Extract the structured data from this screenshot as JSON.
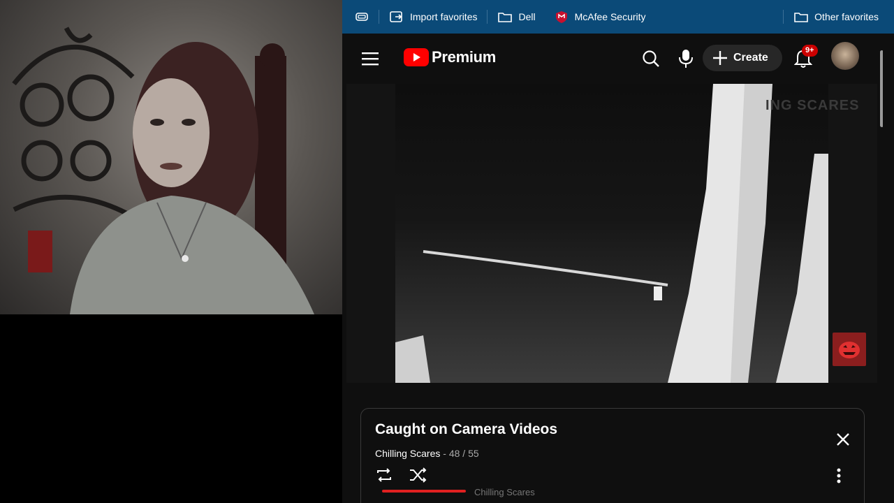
{
  "favorites_bar": {
    "items": [
      {
        "label": "Import favorites",
        "icon": "import-icon"
      },
      {
        "label": "Dell",
        "icon": "folder-icon"
      },
      {
        "label": "McAfee Security",
        "icon": "mcafee-shield-icon"
      }
    ],
    "other_favorites": {
      "label": "Other favorites",
      "icon": "folder-icon"
    }
  },
  "youtube": {
    "logo_text": "Premium",
    "create_label": "Create",
    "notification_badge": "9+",
    "accent_color": "#ff0000"
  },
  "video": {
    "watermark": "ING SCARES"
  },
  "playlist": {
    "title": "Caught on Camera Videos",
    "channel": "Chilling Scares",
    "separator": " - ",
    "position": "48 / 55",
    "next_item_channel": "Chilling Scares"
  }
}
